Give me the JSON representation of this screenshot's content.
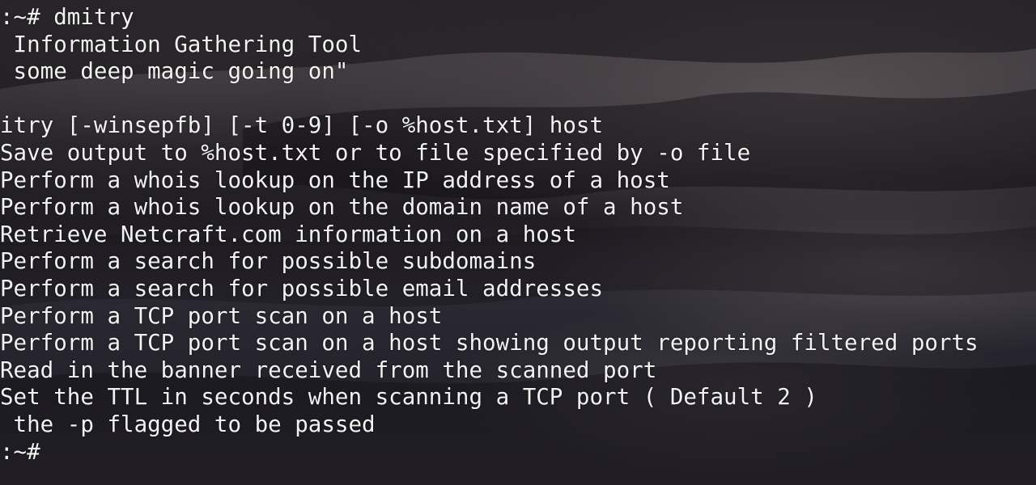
{
  "terminal": {
    "lines": [
      ":~# dmitry",
      " Information Gathering Tool",
      " some deep magic going on\"",
      "",
      "itry [-winsepfb] [-t 0-9] [-o %host.txt] host",
      "Save output to %host.txt or to file specified by -o file",
      "Perform a whois lookup on the IP address of a host",
      "Perform a whois lookup on the domain name of a host",
      "Retrieve Netcraft.com information on a host",
      "Perform a search for possible subdomains",
      "Perform a search for possible email addresses",
      "Perform a TCP port scan on a host",
      "Perform a TCP port scan on a host showing output reporting filtered ports",
      "Read in the banner received from the scanned port",
      "Set the TTL in seconds when scanning a TCP port ( Default 2 )",
      " the -p flagged to be passed",
      ":~#"
    ]
  },
  "colors": {
    "text": "#f2f2f2",
    "background": "#1e1d22"
  }
}
